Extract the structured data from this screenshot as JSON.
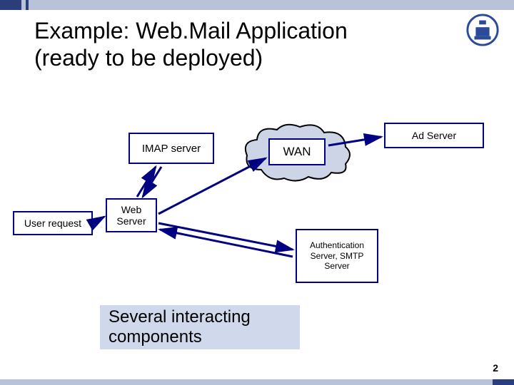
{
  "title_line1": "Example: Web.Mail Application",
  "title_line2": "(ready to be deployed)",
  "nodes": {
    "imap": "IMAP server",
    "ad": "Ad Server",
    "user": "User request",
    "web": "Web Server",
    "auth": "Authentication Server, SMTP Server",
    "wan": "WAN"
  },
  "caption": "Several interacting components",
  "page_number": "2",
  "colors": {
    "border": "#000080",
    "cloud": "#b8c2d8",
    "caption_bg": "#d0d8ec"
  }
}
